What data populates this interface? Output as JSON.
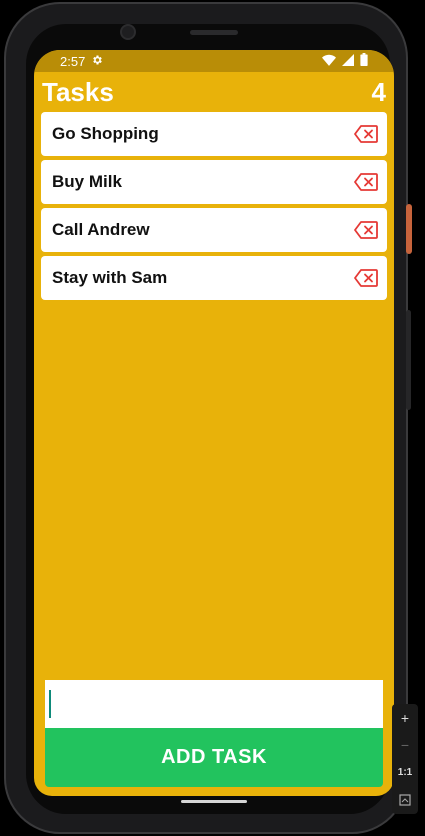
{
  "status_bar": {
    "time": "2:57",
    "icons": [
      "gear-icon",
      "wifi-icon",
      "signal-icon",
      "battery-icon"
    ]
  },
  "header": {
    "title": "Tasks",
    "count": "4"
  },
  "tasks": [
    {
      "label": "Go Shopping"
    },
    {
      "label": "Buy Milk"
    },
    {
      "label": "Call Andrew"
    },
    {
      "label": "Stay with Sam"
    }
  ],
  "input": {
    "value": "",
    "placeholder": ""
  },
  "add_button": {
    "label": "ADD TASK"
  },
  "zoom_controls": {
    "plus": "+",
    "minus": "−",
    "actual_size": "1:1"
  },
  "colors": {
    "background": "#e8b20a",
    "status_bar": "#b98d07",
    "add_button": "#22c35e",
    "delete_icon": "#e53935",
    "caret": "#0e8a7a"
  }
}
